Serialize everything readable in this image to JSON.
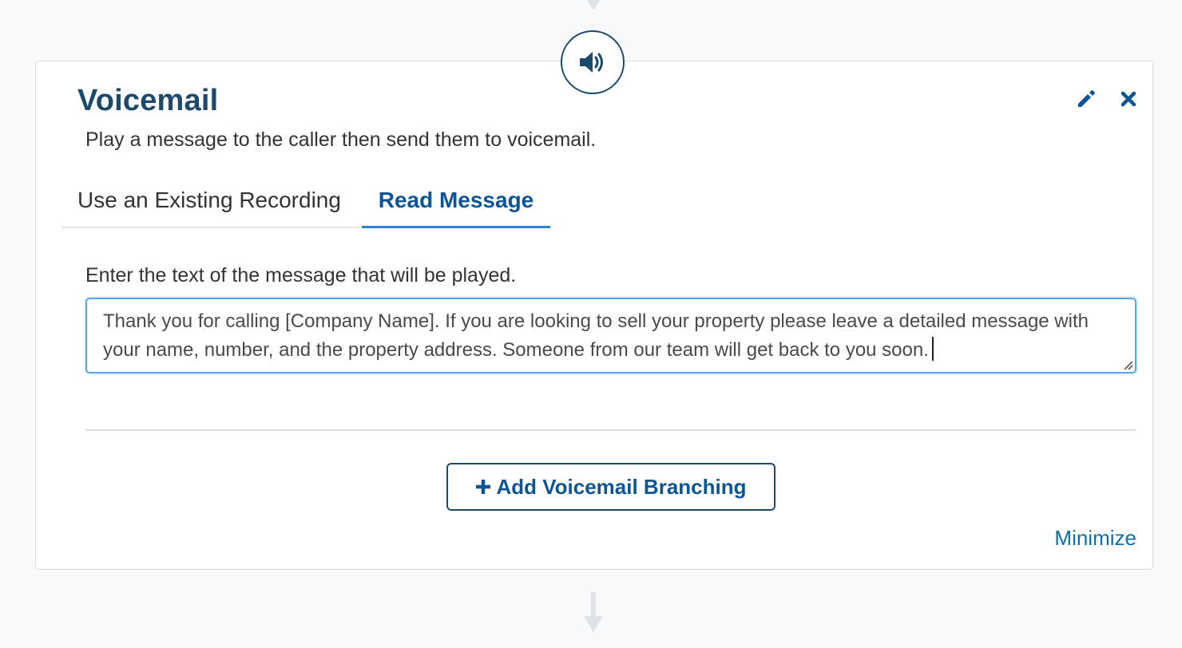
{
  "node": {
    "icon": "speaker-volume-icon",
    "title": "Voicemail",
    "description": "Play a message to the caller then send them to voicemail."
  },
  "header_actions": {
    "edit_icon": "pencil-icon",
    "close_icon": "close-icon"
  },
  "tabs": [
    {
      "label": "Use an Existing Recording",
      "active": false
    },
    {
      "label": "Read Message",
      "active": true
    }
  ],
  "message": {
    "label": "Enter the text of the message that will be played.",
    "value": "Thank you for calling [Company Name]. If you are looking to sell your property please leave a detailed message with your name, number, and the property address. Someone from our team will get back to you soon."
  },
  "branching": {
    "icon": "plus-icon",
    "button_label": "Add Voicemail Branching"
  },
  "footer": {
    "minimize_label": "Minimize"
  },
  "colors": {
    "primary_dark": "#1b4a6b",
    "link_blue": "#0d6ea8",
    "active_tab_underline": "#2b82d6",
    "focus_border": "#5aa7e8"
  }
}
